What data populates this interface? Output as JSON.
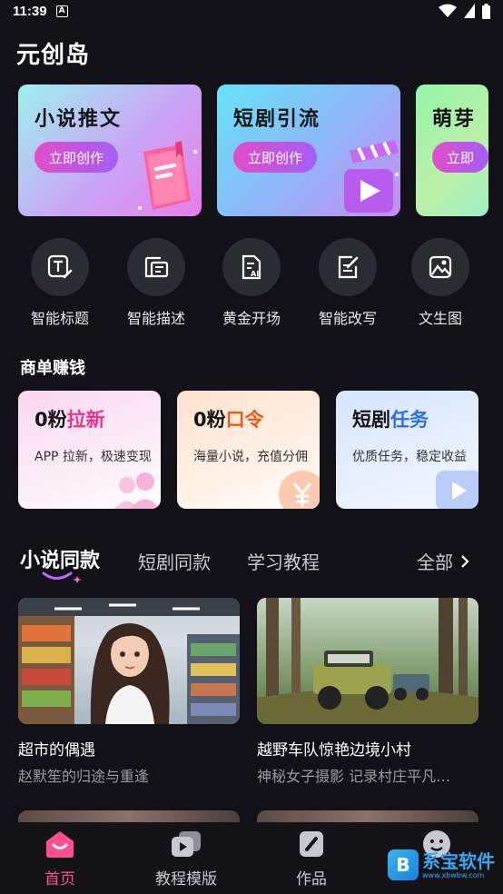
{
  "status": {
    "time": "11:39",
    "a": "A"
  },
  "app_title": "元创岛",
  "banners": [
    {
      "title": "小说推文",
      "button": "立即创作"
    },
    {
      "title": "短剧引流",
      "button": "立即创作"
    },
    {
      "title": "萌芽",
      "button": "立即"
    }
  ],
  "tools": [
    {
      "label": "智能标题",
      "icon": "title-edit-icon"
    },
    {
      "label": "智能描述",
      "icon": "describe-icon"
    },
    {
      "label": "黄金开场",
      "icon": "ai-doc-icon"
    },
    {
      "label": "智能改写",
      "icon": "rewrite-icon"
    },
    {
      "label": "文生图",
      "icon": "image-icon"
    }
  ],
  "earn_section": {
    "title": "商单赚钱"
  },
  "earn_cards": [
    {
      "prefix": "0粉",
      "highlight": "拉新",
      "desc": "APP 拉新，极速变现",
      "color": "#e8348a"
    },
    {
      "prefix": "0粉",
      "highlight": "口令",
      "desc": "海量小说，充值分佣",
      "color": "#ef5a18"
    },
    {
      "prefix": "短剧",
      "highlight": "任务",
      "desc": "优质任务，稳定收益",
      "color": "#2d6ef0"
    }
  ],
  "tabs": {
    "items": [
      "小说同款",
      "短剧同款",
      "学习教程"
    ],
    "active_index": 0,
    "all_label": "全部"
  },
  "cards": [
    {
      "title": "超市的偶遇",
      "subtitle": "赵默笙的归途与重逢"
    },
    {
      "title": "越野车队惊艳边境小村",
      "subtitle": "神秘女子摄影 记录村庄平凡…"
    }
  ],
  "bottom_nav": [
    {
      "label": "首页",
      "icon": "home-icon",
      "active": true
    },
    {
      "label": "教程模版",
      "icon": "play-template-icon",
      "active": false
    },
    {
      "label": "作品",
      "icon": "works-icon",
      "active": false
    },
    {
      "label": "",
      "icon": "profile-icon",
      "active": false
    }
  ],
  "watermark": {
    "text": "系宝软件",
    "url": "www.xbwbw.com"
  },
  "colors": {
    "background": "#121117",
    "accent": "#ff4f8d",
    "button_gradient_start": "#e14ec8",
    "button_gradient_end": "#a35ef5"
  }
}
